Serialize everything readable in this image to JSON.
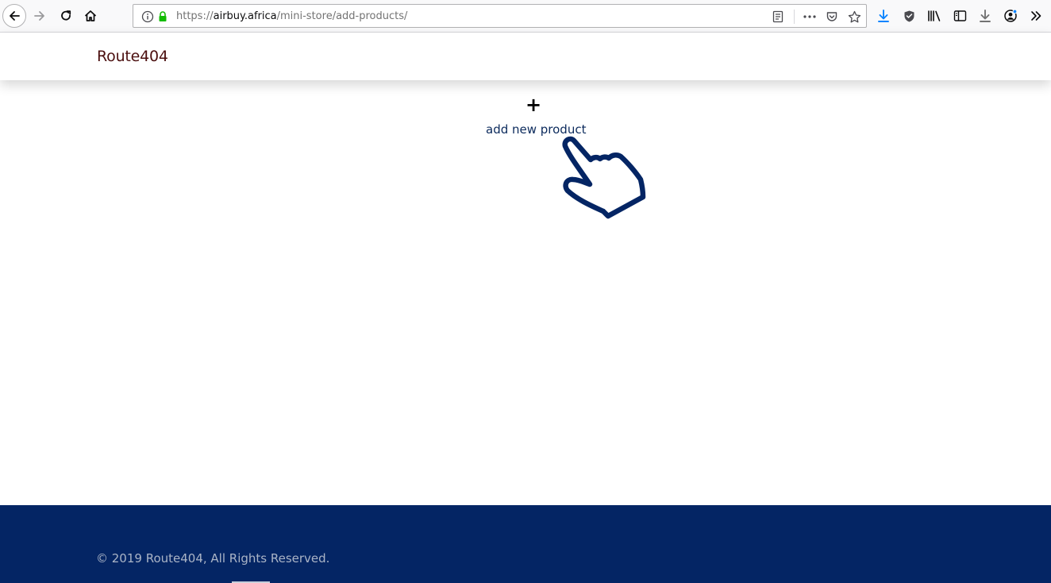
{
  "browser": {
    "url_scheme": "https://",
    "url_host": "airbuy.africa",
    "url_path": "/mini-store/add-products/",
    "icons": {
      "back": "back-arrow-icon",
      "forward": "forward-arrow-icon",
      "reload": "reload-icon",
      "home": "home-icon",
      "info": "info-icon",
      "lock": "lock-icon",
      "reader": "reader-view-icon",
      "more": "more-actions-icon",
      "pocket": "pocket-icon",
      "bookmark": "star-icon",
      "download": "download-icon",
      "shield": "shield-icon",
      "library": "library-icon",
      "sidebar": "sidebar-icon",
      "download2": "download-arrow-icon",
      "account": "account-icon",
      "overflow": "overflow-chevron-icon"
    },
    "colors": {
      "lock": "#12bc00",
      "download": "#0a84ff"
    }
  },
  "header": {
    "brand": "Route404"
  },
  "main": {
    "add_symbol": "+",
    "add_label": "add new product",
    "pointer_icon": "pointing-hand-icon",
    "accent_color": "#042564"
  },
  "footer": {
    "copyright": "© 2019 Route404, All Rights Reserved.",
    "background": "#042564"
  }
}
